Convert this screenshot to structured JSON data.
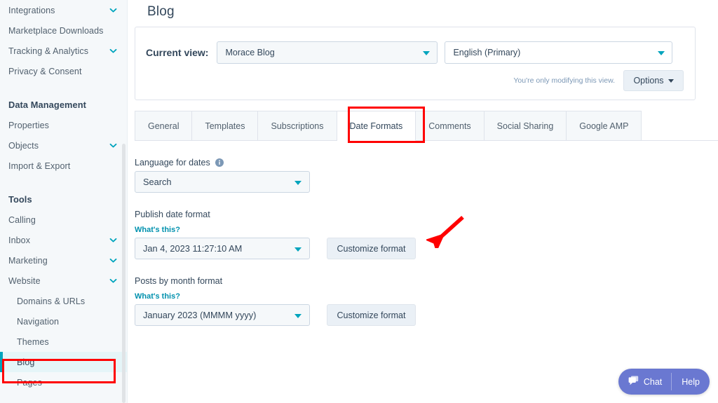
{
  "sidebar": {
    "items": [
      {
        "label": "Integrations",
        "chevron": "chevron-down-icon",
        "indent": false,
        "section": false,
        "selected": false,
        "spacer": false
      },
      {
        "label": "Marketplace Downloads",
        "chevron": null,
        "indent": false,
        "section": false,
        "selected": false,
        "spacer": false
      },
      {
        "label": "Tracking & Analytics",
        "chevron": "chevron-down-icon",
        "indent": false,
        "section": false,
        "selected": false,
        "spacer": false
      },
      {
        "label": "Privacy & Consent",
        "chevron": null,
        "indent": false,
        "section": false,
        "selected": false,
        "spacer": false
      },
      {
        "label": "Data Management",
        "chevron": null,
        "indent": false,
        "section": true,
        "selected": false,
        "spacer": true
      },
      {
        "label": "Properties",
        "chevron": null,
        "indent": false,
        "section": false,
        "selected": false,
        "spacer": false
      },
      {
        "label": "Objects",
        "chevron": "chevron-down-icon",
        "indent": false,
        "section": false,
        "selected": false,
        "spacer": false
      },
      {
        "label": "Import & Export",
        "chevron": null,
        "indent": false,
        "section": false,
        "selected": false,
        "spacer": false
      },
      {
        "label": "Tools",
        "chevron": null,
        "indent": false,
        "section": true,
        "selected": false,
        "spacer": true
      },
      {
        "label": "Calling",
        "chevron": null,
        "indent": false,
        "section": false,
        "selected": false,
        "spacer": false
      },
      {
        "label": "Inbox",
        "chevron": "chevron-down-icon",
        "indent": false,
        "section": false,
        "selected": false,
        "spacer": false
      },
      {
        "label": "Marketing",
        "chevron": "chevron-down-icon",
        "indent": false,
        "section": false,
        "selected": false,
        "spacer": false
      },
      {
        "label": "Website",
        "chevron": "chevron-down-icon",
        "indent": false,
        "section": false,
        "selected": false,
        "spacer": false
      },
      {
        "label": "Domains & URLs",
        "chevron": null,
        "indent": true,
        "section": false,
        "selected": false,
        "spacer": false
      },
      {
        "label": "Navigation",
        "chevron": null,
        "indent": true,
        "section": false,
        "selected": false,
        "spacer": false
      },
      {
        "label": "Themes",
        "chevron": null,
        "indent": true,
        "section": false,
        "selected": false,
        "spacer": false
      },
      {
        "label": "Blog",
        "chevron": null,
        "indent": true,
        "section": false,
        "selected": true,
        "spacer": false
      },
      {
        "label": "Pages",
        "chevron": null,
        "indent": true,
        "section": false,
        "selected": false,
        "spacer": false
      }
    ]
  },
  "main": {
    "page_title": "Blog",
    "view_card": {
      "label": "Current view:",
      "view_select_value": "Morace Blog",
      "language_select_value": "English (Primary)",
      "modify_note": "You're only modifying this view.",
      "options_label": "Options"
    },
    "tabs": [
      {
        "label": "General",
        "active": false
      },
      {
        "label": "Templates",
        "active": false
      },
      {
        "label": "Subscriptions",
        "active": false
      },
      {
        "label": "Date Formats",
        "active": true
      },
      {
        "label": "Comments",
        "active": false
      },
      {
        "label": "Social Sharing",
        "active": false
      },
      {
        "label": "Google AMP",
        "active": false
      }
    ],
    "form": {
      "language_for_dates": {
        "label": "Language for dates",
        "info_icon": "info-icon",
        "select_value": "Search"
      },
      "publish_date_format": {
        "label": "Publish date format",
        "whats_this": "What's this?",
        "select_value": "Jan 4, 2023 11:27:10 AM",
        "customize_label": "Customize format"
      },
      "posts_by_month_format": {
        "label": "Posts by month format",
        "whats_this": "What's this?",
        "select_value": "January 2023 (MMMM yyyy)",
        "customize_label": "Customize format"
      }
    }
  },
  "chat_widget": {
    "chat_label": "Chat",
    "chat_icon": "chat-bubble-icon",
    "help_label": "Help"
  },
  "colors": {
    "sidebar_bg": "#f5f8fa",
    "accent_teal": "#00a4bd",
    "selected_bg": "#e5f5f8",
    "text_primary": "#33475b",
    "text_secondary": "#51606e",
    "link": "#0091ae",
    "border": "#dfe3eb",
    "chat_purple": "#6a78d1",
    "annotation_red": "#ff0000"
  }
}
